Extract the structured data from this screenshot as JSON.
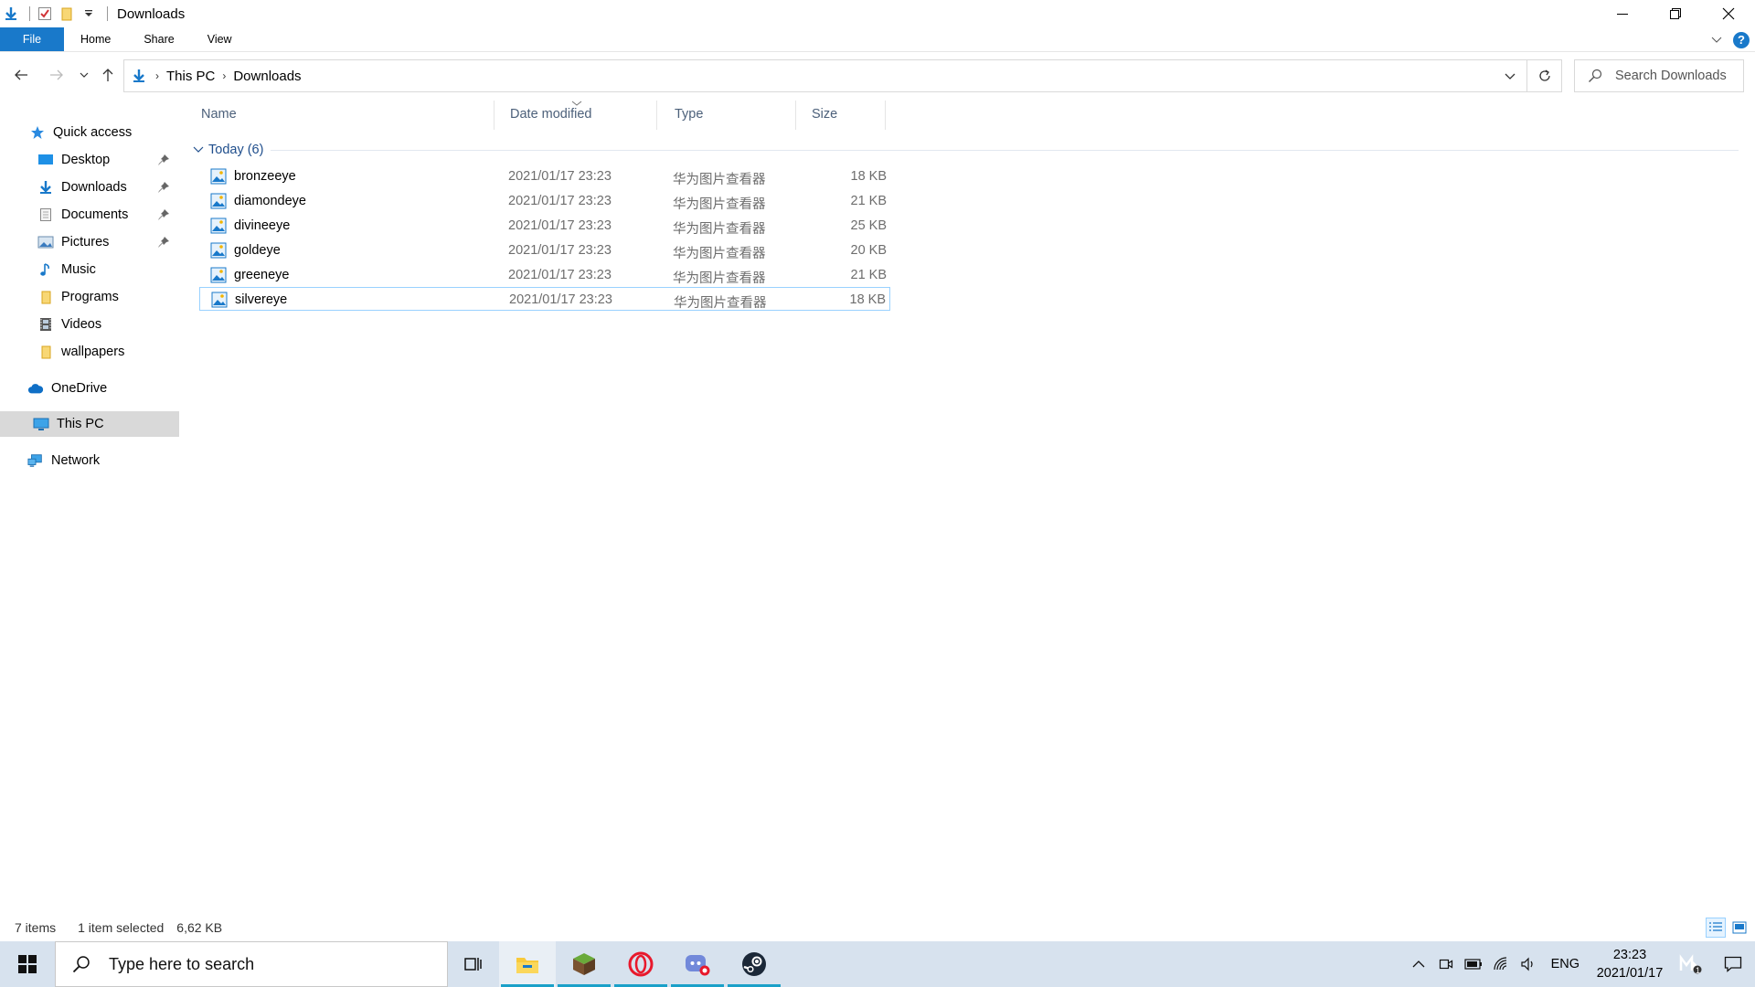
{
  "window": {
    "title": "Downloads"
  },
  "ribbon": {
    "tabs": [
      {
        "label": "File"
      },
      {
        "label": "Home"
      },
      {
        "label": "Share"
      },
      {
        "label": "View"
      }
    ],
    "help": "?"
  },
  "address": {
    "crumbs": [
      "This PC",
      "Downloads"
    ]
  },
  "search": {
    "placeholder": "Search Downloads"
  },
  "sidebar": {
    "quick_access": "Quick access",
    "items": [
      {
        "label": "Desktop",
        "icon": "desktop-icon",
        "pinned": true
      },
      {
        "label": "Downloads",
        "icon": "downloads-icon",
        "pinned": true
      },
      {
        "label": "Documents",
        "icon": "documents-icon",
        "pinned": true
      },
      {
        "label": "Pictures",
        "icon": "pictures-icon",
        "pinned": true
      },
      {
        "label": "Music",
        "icon": "music-icon",
        "pinned": false
      },
      {
        "label": "Programs",
        "icon": "folder-icon",
        "pinned": false
      },
      {
        "label": "Videos",
        "icon": "videos-icon",
        "pinned": false
      },
      {
        "label": "wallpapers",
        "icon": "folder-icon",
        "pinned": false
      }
    ],
    "onedrive": "OneDrive",
    "this_pc": "This PC",
    "network": "Network"
  },
  "columns": {
    "name": "Name",
    "date": "Date modified",
    "type": "Type",
    "size": "Size"
  },
  "group": {
    "label": "Today (6)"
  },
  "files": [
    {
      "name": "bronzeeye",
      "date": "2021/01/17 23:23",
      "type": "华为图片查看器",
      "size": "18 KB"
    },
    {
      "name": "diamondeye",
      "date": "2021/01/17 23:23",
      "type": "华为图片查看器",
      "size": "21 KB"
    },
    {
      "name": "divineeye",
      "date": "2021/01/17 23:23",
      "type": "华为图片查看器",
      "size": "25 KB"
    },
    {
      "name": "goldeye",
      "date": "2021/01/17 23:23",
      "type": "华为图片查看器",
      "size": "20 KB"
    },
    {
      "name": "greeneye",
      "date": "2021/01/17 23:23",
      "type": "华为图片查看器",
      "size": "21 KB"
    },
    {
      "name": "silvereye",
      "date": "2021/01/17 23:23",
      "type": "华为图片查看器",
      "size": "18 KB",
      "selected": true
    }
  ],
  "status": {
    "items": "7 items",
    "selected": "1 item selected",
    "size": "6,62 KB"
  },
  "taskbar": {
    "search_placeholder": "Type here to search",
    "apps": [
      "task-view-icon",
      "file-explorer-icon",
      "minecraft-icon",
      "opera-icon",
      "discord-icon",
      "steam-icon"
    ],
    "lang": "ENG",
    "time": "23:23",
    "date": "2021/01/17",
    "badge": "1"
  },
  "colors": {
    "accent": "#1979ca",
    "selection_border": "#99d1ff",
    "taskbar": "#d7e2ee"
  }
}
